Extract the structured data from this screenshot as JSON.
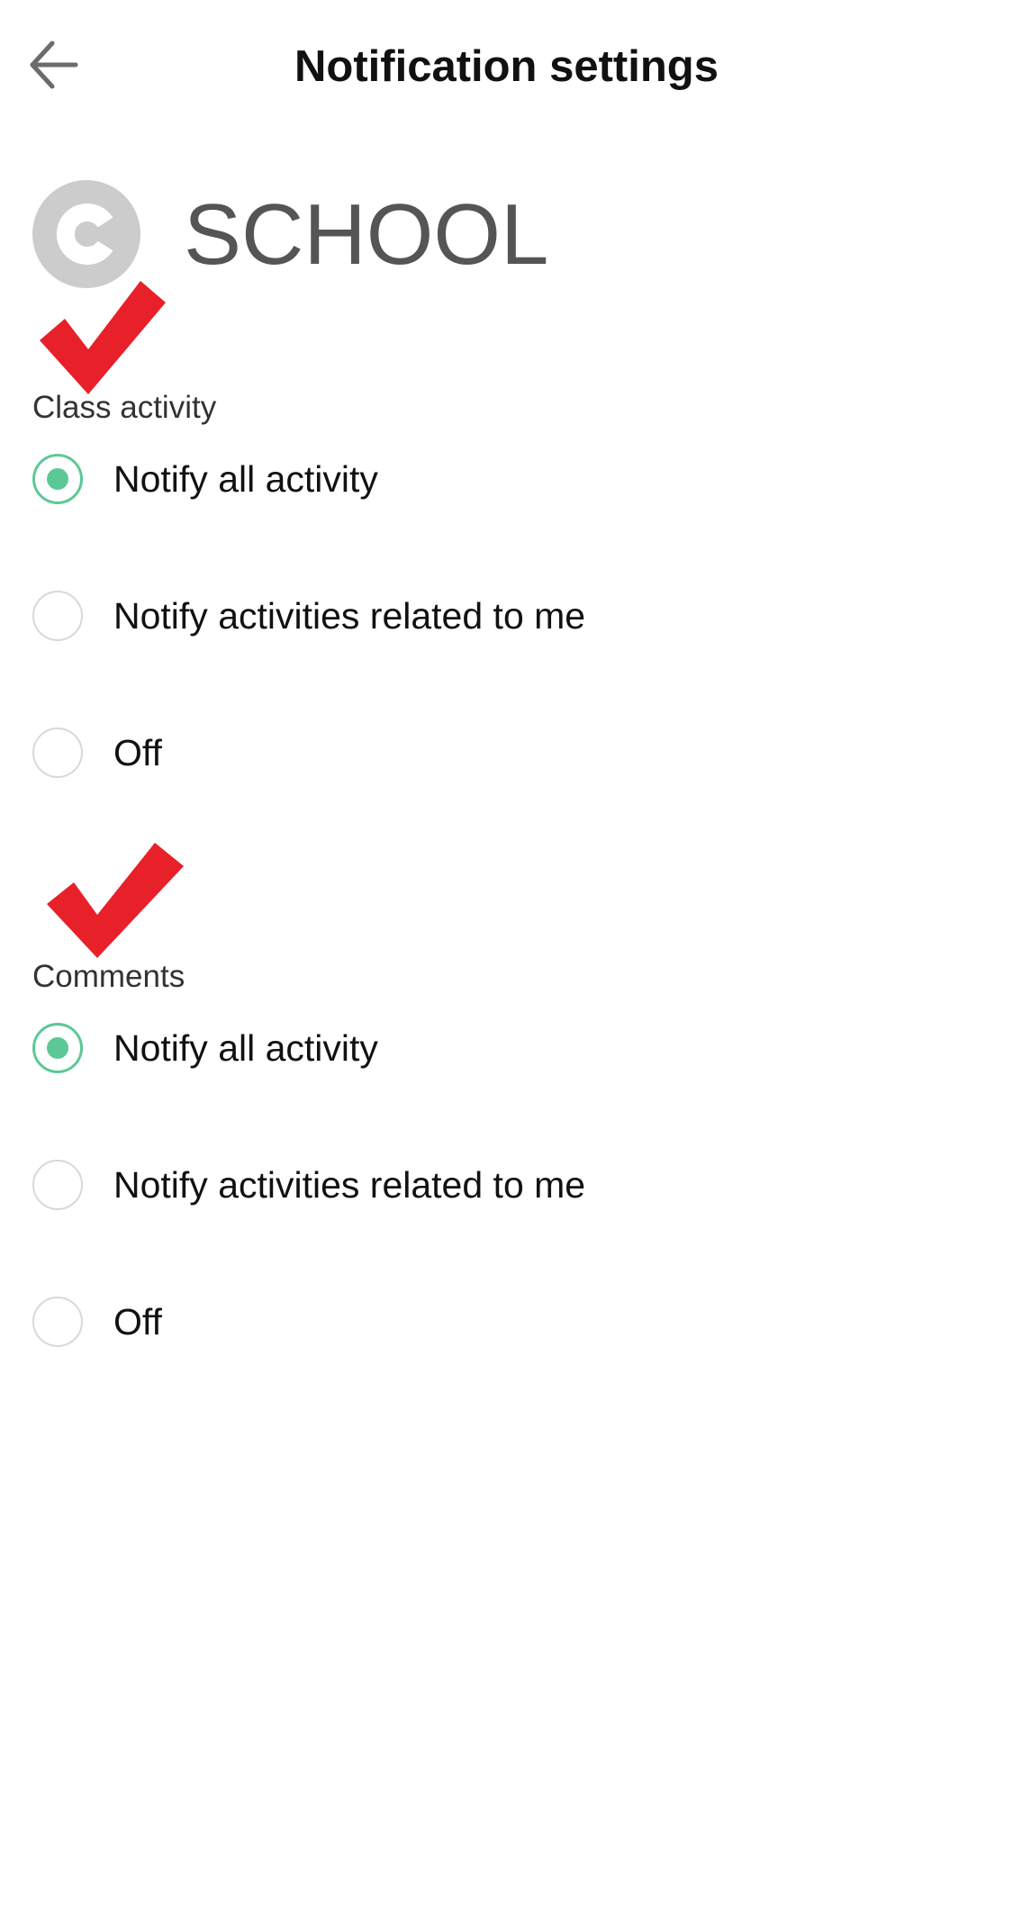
{
  "header": {
    "title": "Notification settings",
    "back_icon": "arrow-left-icon"
  },
  "class_info": {
    "avatar_icon": "letter-c-icon",
    "avatar_color": "#cccccc",
    "name": "SCHOOL"
  },
  "annotation": {
    "icon": "red-checkmark-icon",
    "color": "#e8202a"
  },
  "sections": [
    {
      "title": "Class activity",
      "options": [
        {
          "label": "Notify all activity",
          "selected": true
        },
        {
          "label": "Notify activities related to me",
          "selected": false
        },
        {
          "label": "Off",
          "selected": false
        }
      ]
    },
    {
      "title": "Comments",
      "options": [
        {
          "label": "Notify all activity",
          "selected": true
        },
        {
          "label": "Notify activities related to me",
          "selected": false
        },
        {
          "label": "Off",
          "selected": false
        }
      ]
    }
  ],
  "accent_color": "#5cc897"
}
